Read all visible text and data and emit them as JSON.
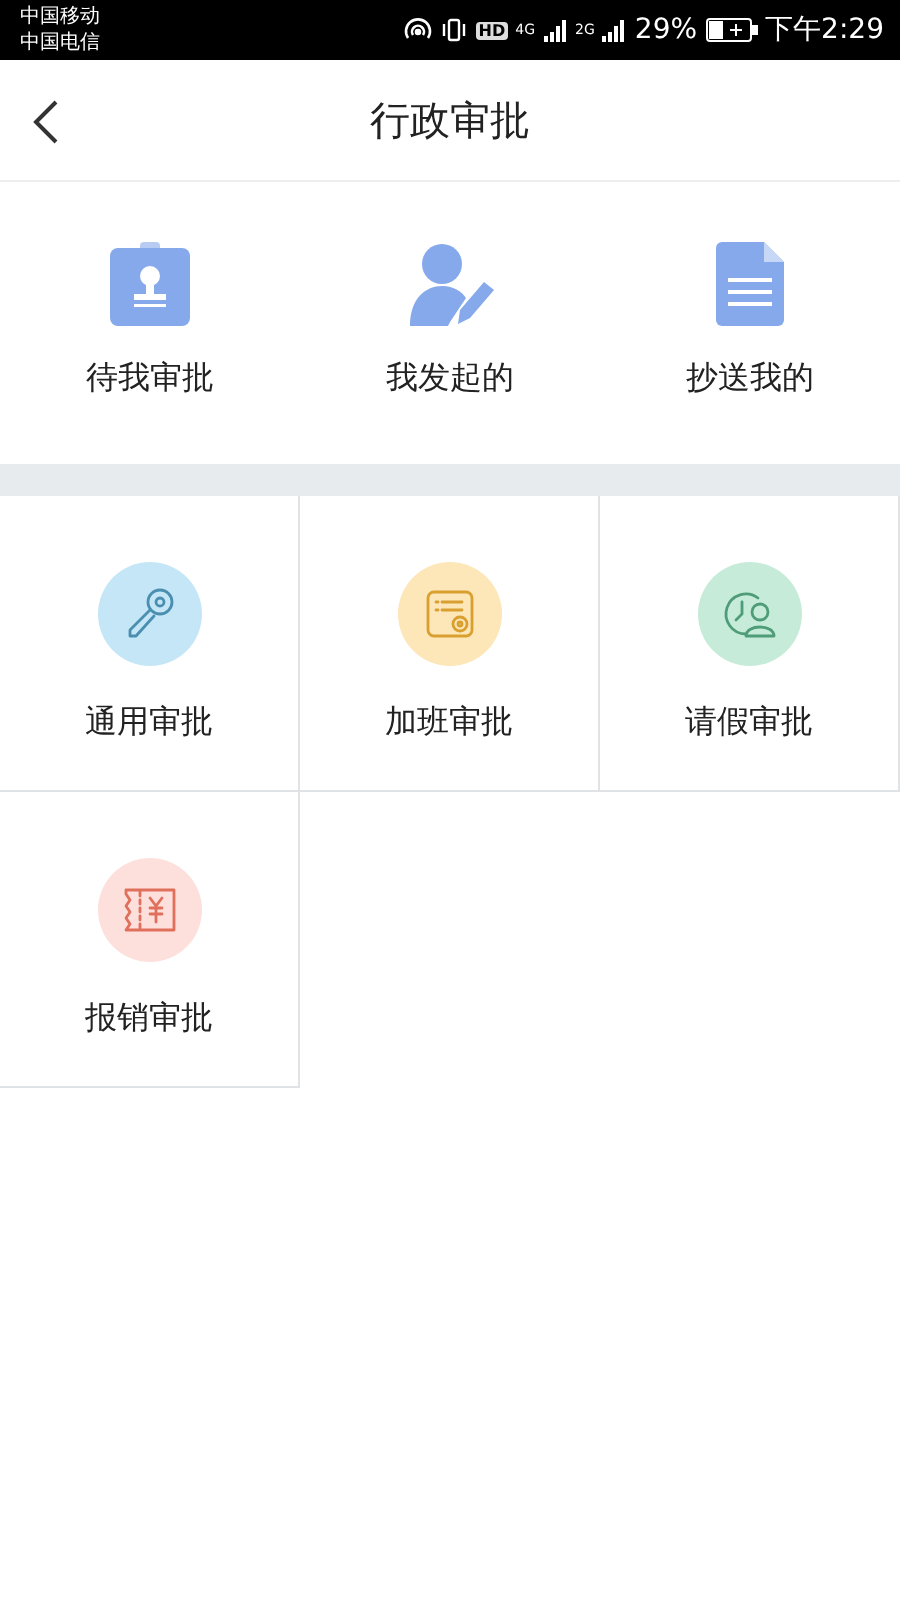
{
  "status_bar": {
    "carriers": [
      "中国移动",
      "中国电信"
    ],
    "hd": "HD",
    "network_1": "4G",
    "network_2": "2G",
    "battery": "29%",
    "time": "下午2:29"
  },
  "header": {
    "title": "行政审批"
  },
  "quick_actions": [
    {
      "kind": "badge",
      "label": "待我审批"
    },
    {
      "kind": "person",
      "label": "我发起的"
    },
    {
      "kind": "document",
      "label": "抄送我的"
    }
  ],
  "approval_types": [
    {
      "kind": "key",
      "label": "通用审批",
      "color": "#c4e6f7"
    },
    {
      "kind": "calendar",
      "label": "加班审批",
      "color": "#fde6b8"
    },
    {
      "kind": "clock",
      "label": "请假审批",
      "color": "#c6ecd9"
    },
    {
      "kind": "receipt",
      "label": "报销审批",
      "color": "#fde0dc"
    }
  ]
}
